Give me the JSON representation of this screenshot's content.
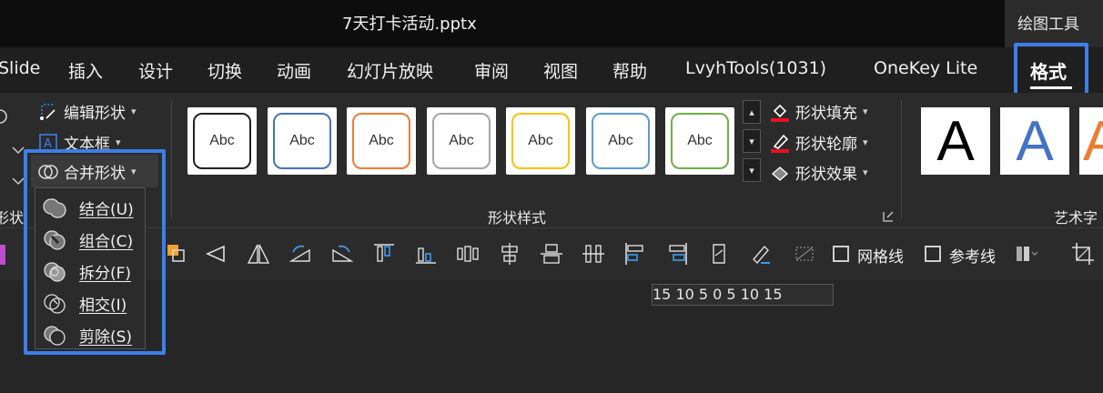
{
  "titlebar": {
    "title": "7天打卡活动.pptx",
    "tool_context": "绘图工具"
  },
  "menu": {
    "items": [
      "Slide",
      "插入",
      "设计",
      "切换",
      "动画",
      "幻灯片放映",
      "审阅",
      "视图",
      "帮助",
      "LvyhTools(1031)",
      "OneKey Lite"
    ],
    "active": "格式"
  },
  "ribbon": {
    "insert_shapes": {
      "edit_shape": "编辑形状",
      "text_box": "文本框",
      "merge_shapes": "合并形状",
      "group_label": "形状"
    },
    "shape_styles": {
      "group_label": "形状样式",
      "sample_text": "Abc",
      "styles": [
        {
          "border": "#222222"
        },
        {
          "border": "#4472c4"
        },
        {
          "border": "#ed7d31"
        },
        {
          "border": "#a5a5a5"
        },
        {
          "border": "#ffc000"
        },
        {
          "border": "#5b9bd5"
        },
        {
          "border": "#70ad47"
        }
      ],
      "fill": "形状填充",
      "outline": "形状轮廓",
      "effects": "形状效果"
    },
    "wordart": {
      "group_label": "艺术字",
      "letter": "A",
      "colors": [
        "#000000",
        "#4472c4",
        "#ed7d31"
      ]
    }
  },
  "merge_menu": {
    "items": [
      {
        "label": "结合(U)"
      },
      {
        "label": "组合(C)"
      },
      {
        "label": "拆分(F)"
      },
      {
        "label": "相交(I)"
      },
      {
        "label": "剪除(S)"
      }
    ]
  },
  "toolbar2": {
    "gridlines": "网格线",
    "guides": "参考线"
  },
  "ruler": {
    "text": "15 10 5   0   5  10 15"
  },
  "colors": {
    "accent_highlight": "#3d7ee8",
    "fill_red": "#e81123"
  }
}
